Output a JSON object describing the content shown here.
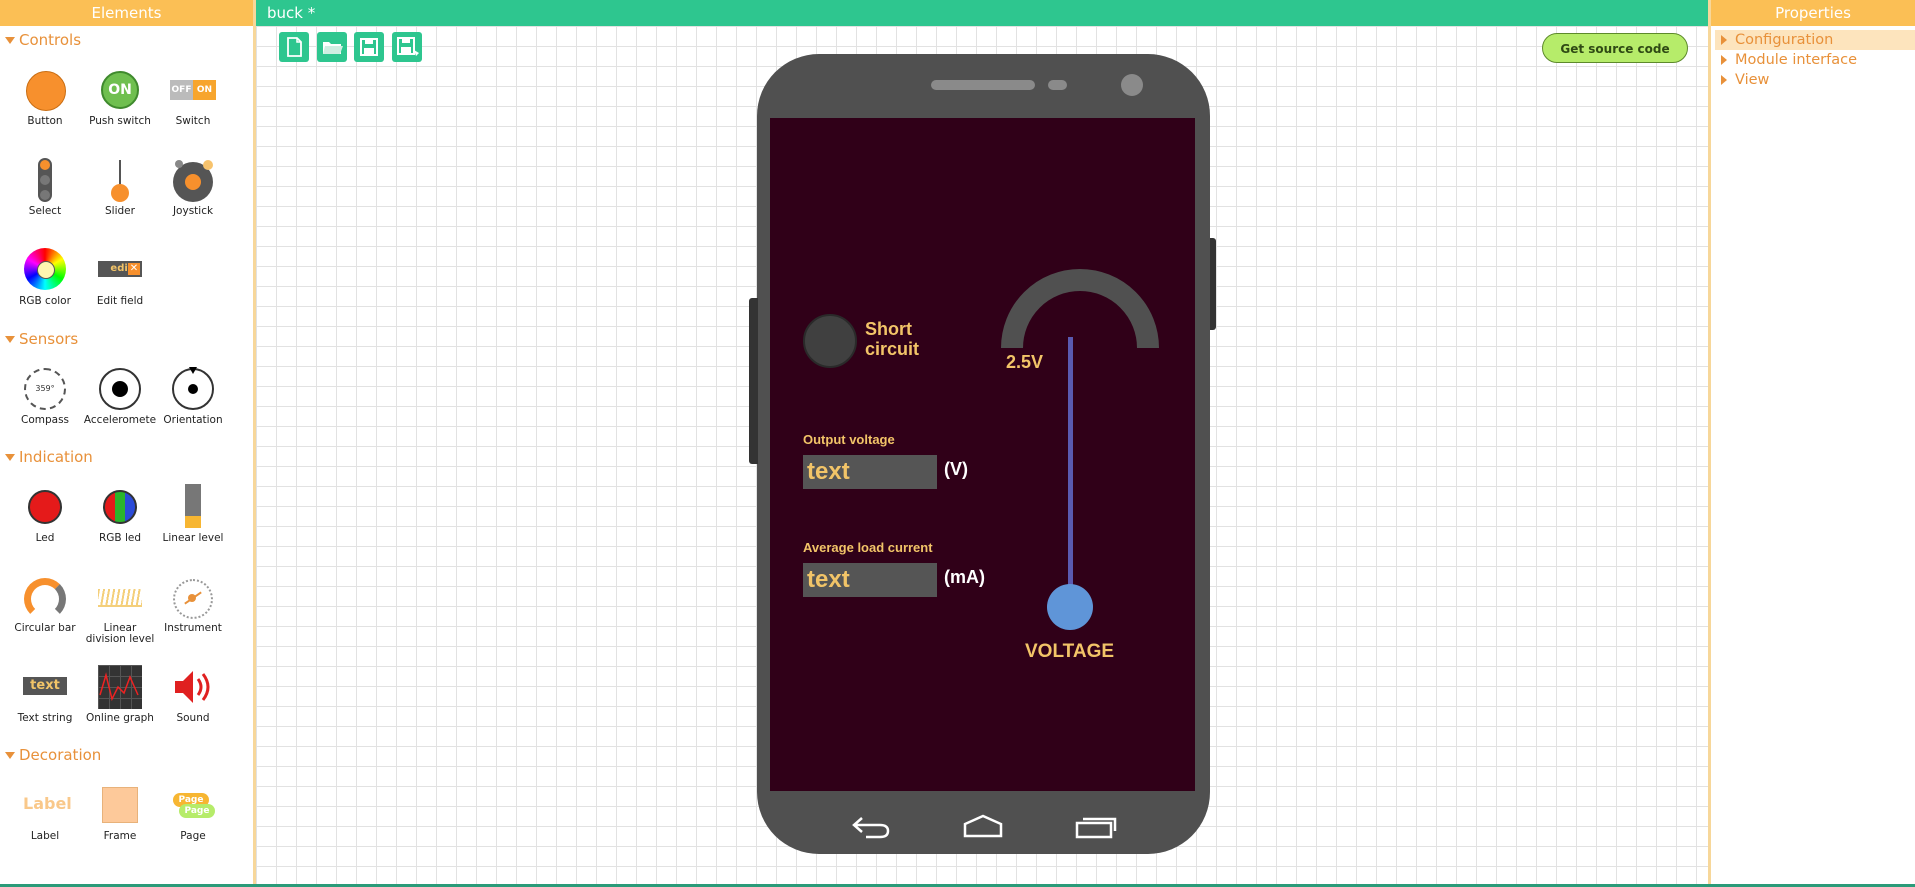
{
  "left_panel": {
    "title": "Elements",
    "sections": {
      "controls": "Controls",
      "sensors": "Sensors",
      "indication": "Indication",
      "decoration": "Decoration"
    },
    "controls": [
      "Button",
      "Push switch",
      "Switch",
      "Select",
      "Slider",
      "Joystick",
      "RGB color",
      "Edit field"
    ],
    "sensors": [
      "Compass",
      "Acceleromete",
      "Orientation"
    ],
    "indication": [
      "Led",
      "RGB led",
      "Linear level",
      "Circular bar",
      "Linear division level",
      "Instrument",
      "Text string",
      "Online graph",
      "Sound"
    ],
    "decoration": [
      "Label",
      "Frame",
      "Page"
    ],
    "icon_text": {
      "push_on": "ON",
      "switch_off": "OFF",
      "switch_on": "ON",
      "edit": "edit",
      "compass": "359°",
      "text_string": "text",
      "label": "Label",
      "page_1": "Page",
      "page_2": "Page"
    }
  },
  "topbar": {
    "title": "buck *"
  },
  "toolbar": {
    "icons": [
      "new-file-icon",
      "open-folder-icon",
      "save-icon",
      "save-as-icon"
    ],
    "get_source_label": "Get source code"
  },
  "right_panel": {
    "title": "Properties",
    "items": [
      "Configuration",
      "Module interface",
      "View"
    ],
    "selected": "Configuration"
  },
  "phone_screen": {
    "led_label_1": "Short",
    "led_label_2": "circuit",
    "slider_value": "2.5V",
    "slider_level": 0,
    "slider_caption": "VOLTAGE",
    "output_voltage_label": "Output voltage",
    "output_voltage_text": "text",
    "output_voltage_unit": "(V)",
    "load_current_label": "Average load current",
    "load_current_text": "text",
    "load_current_unit": "(mA)"
  },
  "colors": {
    "accent_orange": "#fbbf55",
    "header_green": "#2ec68f",
    "screen_bg": "#300018",
    "text_yellow": "#f2c468"
  }
}
